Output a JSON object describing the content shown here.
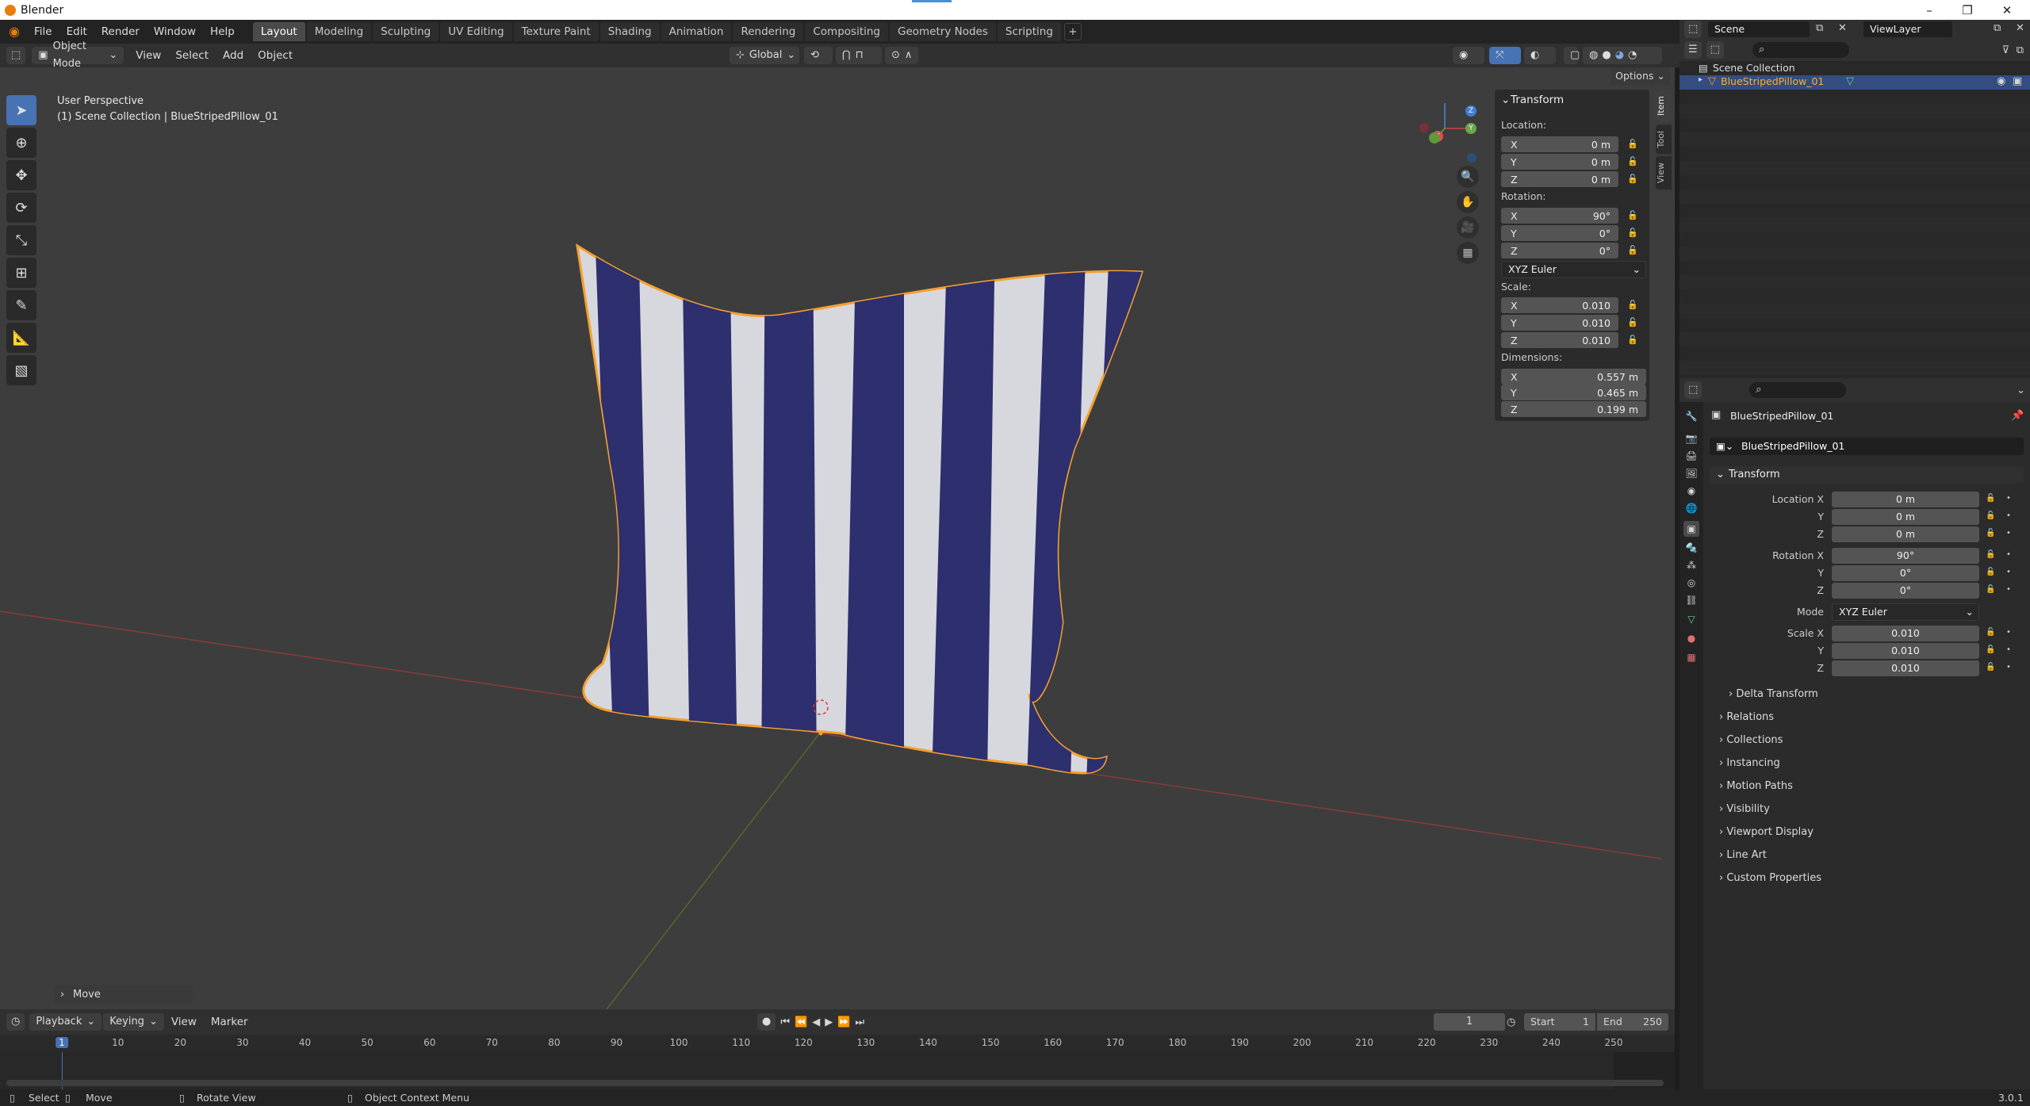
{
  "window": {
    "title": "Blender",
    "controls": [
      "–",
      "❐",
      "✕"
    ]
  },
  "topbar": {
    "menus": [
      "File",
      "Edit",
      "Render",
      "Window",
      "Help"
    ],
    "tabs": [
      "Layout",
      "Modeling",
      "Sculpting",
      "UV Editing",
      "Texture Paint",
      "Shading",
      "Animation",
      "Rendering",
      "Compositing",
      "Geometry Nodes",
      "Scripting"
    ],
    "active_tab": "Layout",
    "add_tab": "+",
    "scene": "Scene",
    "view_layer": "ViewLayer"
  },
  "header": {
    "mode": "Object Mode",
    "menus": [
      "View",
      "Select",
      "Add",
      "Object"
    ],
    "orientation": "Global",
    "options": "Options"
  },
  "viewport": {
    "perspective": "User Perspective",
    "collection_info": "(1) Scene Collection | BlueStripedPillow_01",
    "move_panel": "Move",
    "gizmo": {
      "x": "X",
      "y": "Y",
      "z": "Z"
    },
    "vtabs": [
      "Item",
      "Tool",
      "View"
    ]
  },
  "npanel": {
    "title": "Transform",
    "location_label": "Location:",
    "rotation_label": "Rotation:",
    "scale_label": "Scale:",
    "dimensions_label": "Dimensions:",
    "location": [
      {
        "axis": "X",
        "value": "0 m"
      },
      {
        "axis": "Y",
        "value": "0 m"
      },
      {
        "axis": "Z",
        "value": "0 m"
      }
    ],
    "rotation": [
      {
        "axis": "X",
        "value": "90°"
      },
      {
        "axis": "Y",
        "value": "0°"
      },
      {
        "axis": "Z",
        "value": "0°"
      }
    ],
    "rotation_mode": "XYZ Euler",
    "scale": [
      {
        "axis": "X",
        "value": "0.010"
      },
      {
        "axis": "Y",
        "value": "0.010"
      },
      {
        "axis": "Z",
        "value": "0.010"
      }
    ],
    "dimensions": [
      {
        "axis": "X",
        "value": "0.557 m"
      },
      {
        "axis": "Y",
        "value": "0.465 m"
      },
      {
        "axis": "Z",
        "value": "0.199 m"
      }
    ]
  },
  "timeline": {
    "menus": [
      "Playback",
      "Keying",
      "View",
      "Marker"
    ],
    "current_frame": "1",
    "start_label": "Start",
    "start": "1",
    "end_label": "End",
    "end": "250",
    "ticks": [
      "1",
      "10",
      "20",
      "30",
      "40",
      "50",
      "60",
      "70",
      "80",
      "90",
      "100",
      "110",
      "120",
      "130",
      "140",
      "150",
      "160",
      "170",
      "180",
      "190",
      "200",
      "210",
      "220",
      "230",
      "240",
      "250"
    ]
  },
  "status": {
    "select": "Select",
    "move": "Move",
    "rotate": "Rotate View",
    "context": "Object Context Menu",
    "version": "3.0.1"
  },
  "outliner": {
    "root": "Scene Collection",
    "object": "BlueStripedPillow_01"
  },
  "properties": {
    "object_name": "BlueStripedPillow_01",
    "object_field": "BlueStripedPillow_01",
    "transform_title": "Transform",
    "location_label": "Location X",
    "rotation_label": "Rotation X",
    "scale_label": "Scale X",
    "mode_label": "Mode",
    "y": "Y",
    "z": "Z",
    "location": [
      "0 m",
      "0 m",
      "0 m"
    ],
    "rotation": [
      "90°",
      "0°",
      "0°"
    ],
    "mode": "XYZ Euler",
    "scale": [
      "0.010",
      "0.010",
      "0.010"
    ],
    "delta": "Delta Transform",
    "sections": [
      "Relations",
      "Collections",
      "Instancing",
      "Motion Paths",
      "Visibility",
      "Viewport Display",
      "Line Art",
      "Custom Properties"
    ]
  },
  "colors": {
    "accent": "#4772b3",
    "selection": "#f5a030",
    "pillow_navy": "#2d2f6e",
    "pillow_white": "#d7d8dd"
  }
}
